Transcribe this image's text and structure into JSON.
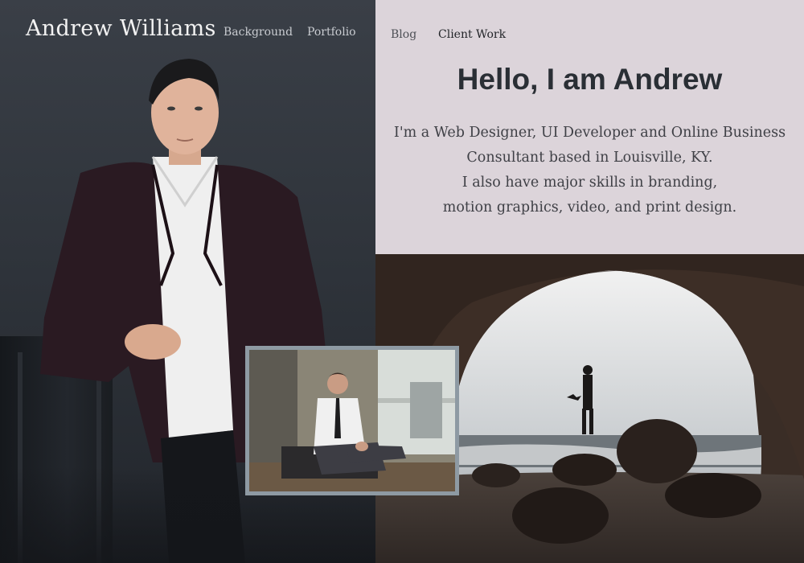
{
  "brand": {
    "name": "Andrew Williams"
  },
  "nav": {
    "items": [
      {
        "label": "Background"
      },
      {
        "label": "Portfolio"
      },
      {
        "label": "Blog"
      },
      {
        "label": "Client Work"
      }
    ]
  },
  "intro": {
    "headline": "Hello, I am Andrew",
    "bio_lines": [
      "I'm a Web Designer, UI Developer and Online Business",
      "Consultant based in Louisville, KY.",
      "I also have major skills in branding,",
      "motion graphics, video, and print design."
    ]
  },
  "colors": {
    "left_panel": "#2f343b",
    "intro_bg": "#dcd4da",
    "headline": "#2a2f35",
    "bio_text": "#3f4046",
    "brand_text": "#f2f2f2",
    "inset_frame": "#8e9aa3"
  }
}
